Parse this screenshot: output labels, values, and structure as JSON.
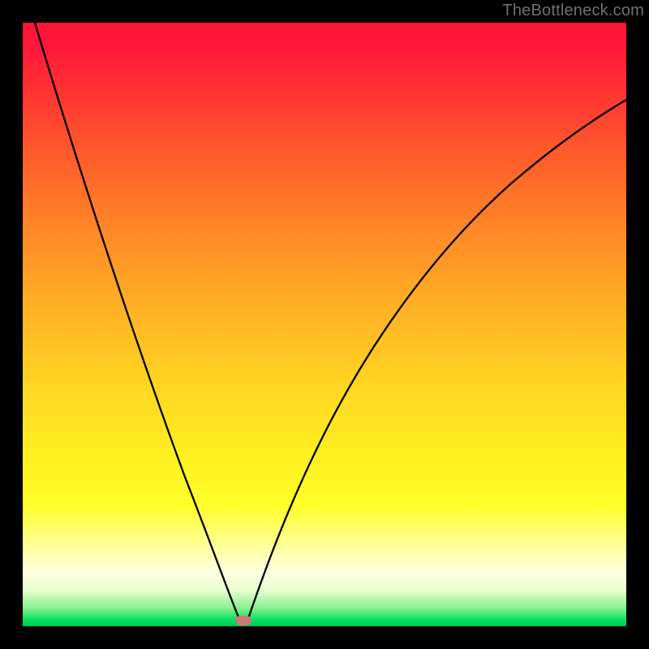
{
  "watermark": "TheBottleneck.com",
  "chart_data": {
    "type": "line",
    "title": "",
    "xlabel": "",
    "ylabel": "",
    "xlim": [
      0,
      100
    ],
    "ylim": [
      0,
      100
    ],
    "series": [
      {
        "name": "bottleneck-curve",
        "x": [
          2,
          10,
          18,
          26,
          32,
          35,
          36.5,
          37,
          40,
          46,
          55,
          66,
          80,
          100
        ],
        "y": [
          100,
          77,
          53,
          28,
          10,
          2,
          0,
          2,
          12,
          30,
          50,
          66,
          80,
          92
        ]
      }
    ],
    "annotations": [
      {
        "name": "valley-marker",
        "x": 36.5,
        "y": 1
      }
    ],
    "gradient_stops": [
      {
        "pos": 0,
        "color": "#ff1434"
      },
      {
        "pos": 50,
        "color": "#ffd522"
      },
      {
        "pos": 85,
        "color": "#ffff2a"
      },
      {
        "pos": 100,
        "color": "#00c850"
      }
    ]
  }
}
